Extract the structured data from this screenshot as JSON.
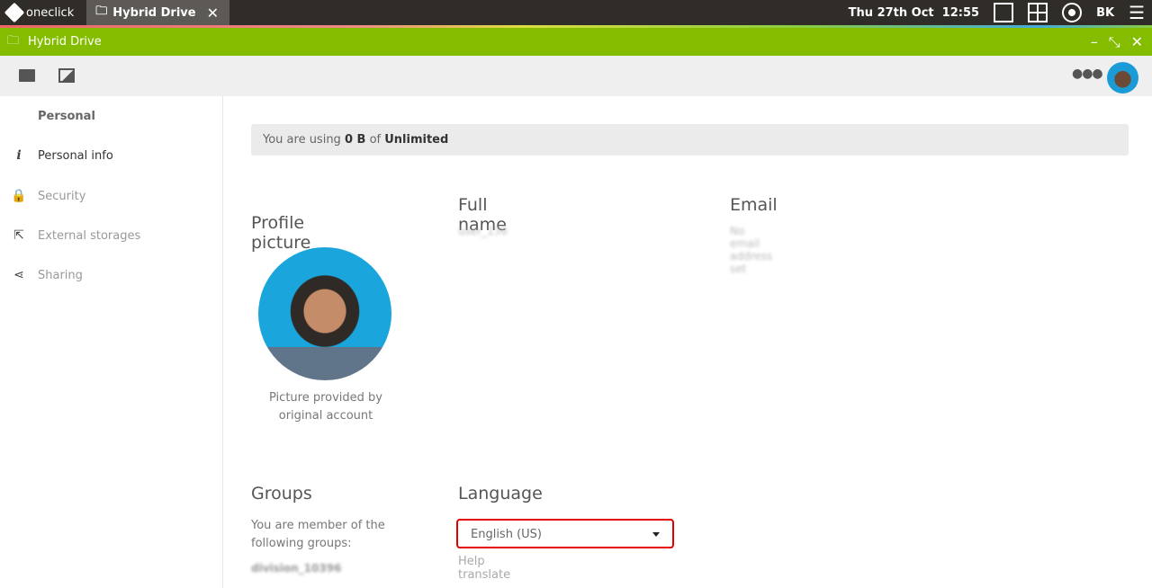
{
  "taskbar": {
    "brand": "oneclick",
    "tab_title": "Hybrid Drive",
    "datetime": "Thu 27th Oct  12:55",
    "user_initials": "BK"
  },
  "window": {
    "title": "Hybrid Drive"
  },
  "sidebar": {
    "heading": "Personal",
    "items": [
      {
        "label": "Personal info",
        "icon": "info-icon"
      },
      {
        "label": "Security",
        "icon": "lock-icon"
      },
      {
        "label": "External storages",
        "icon": "external-link-icon"
      },
      {
        "label": "Sharing",
        "icon": "share-icon"
      }
    ]
  },
  "usage": {
    "prefix": "You are using ",
    "used": "0 B",
    "middle": " of ",
    "quota": "Unlimited"
  },
  "profile": {
    "title": "Profile picture",
    "caption": "Picture provided by original account"
  },
  "fullname": {
    "title": "Full name",
    "value": "user_136"
  },
  "email": {
    "title": "Email",
    "value": "No email address set"
  },
  "groups": {
    "title": "Groups",
    "text": "You are member of the following groups:",
    "value": "division_10396"
  },
  "language": {
    "title": "Language",
    "selected": "English (US)",
    "help": "Help translate"
  },
  "colors": {
    "accent": "#84bd00",
    "highlight": "#e30000"
  }
}
